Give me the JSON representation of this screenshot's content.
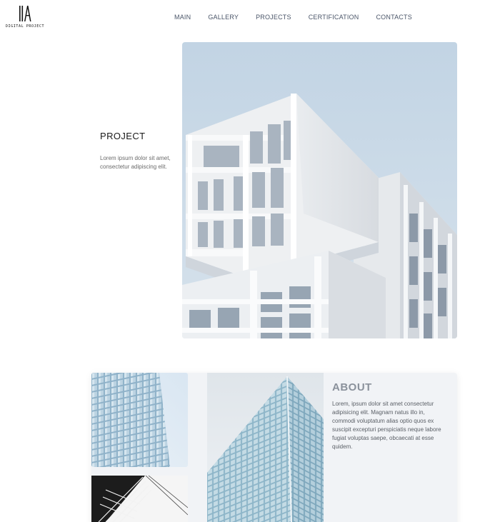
{
  "logo": {
    "text": "DIGITAL PROJECT"
  },
  "nav": {
    "items": [
      {
        "label": "MAIN"
      },
      {
        "label": "GALLERY"
      },
      {
        "label": "PROJECTS"
      },
      {
        "label": "CERTIFICATION"
      },
      {
        "label": "CONTACTS"
      }
    ]
  },
  "hero": {
    "title": "PROJECT",
    "description": "Lorem ipsum dolor sit amet, consectetur adipiscing elit."
  },
  "about": {
    "title": "ABOUT",
    "text": "Lorem, ipsum dolor sit amet consectetur adipisicing elit. Magnam natus illo in, commodi voluptatum alias optio quos ex suscipit excepturi perspiciatis neque labore fugiat voluptas saepe, obcaecati at esse quidem."
  },
  "colors": {
    "sky": "#c5d6e6",
    "building": "#f2f4f6",
    "nav_text": "#4a5568",
    "about_title": "#8a919b",
    "card_bg": "#f1f3f6"
  }
}
